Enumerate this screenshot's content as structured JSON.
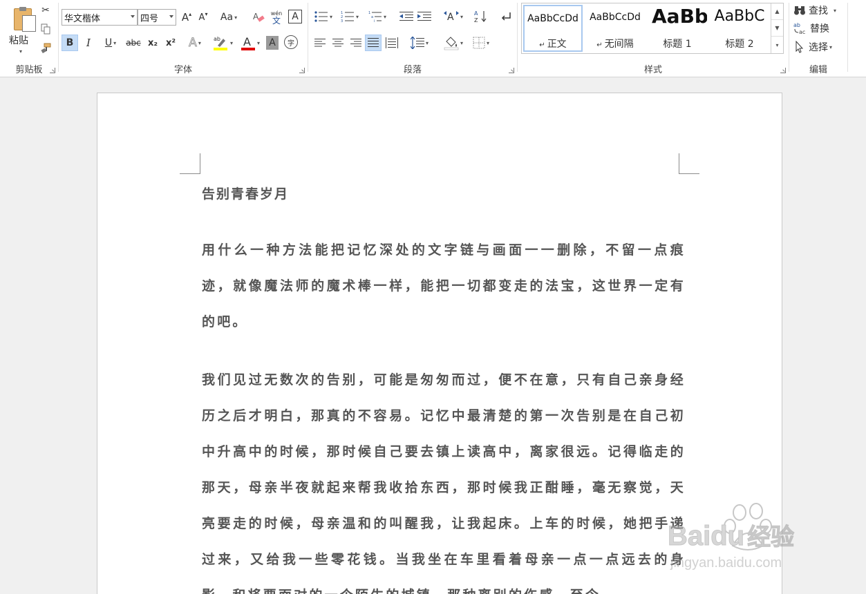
{
  "clipboard": {
    "paste_label": "粘贴",
    "group_label": "剪贴板"
  },
  "font": {
    "family": "华文楷体",
    "size": "四号",
    "group_label": "字体",
    "change_case_label": "Aa",
    "bold": "B",
    "italic": "I",
    "underline": "U",
    "strikethrough": "abc",
    "subscript": "x₂",
    "superscript": "x²",
    "phonetic_top": "wén",
    "phonetic_bottom": "文",
    "border_char": "A",
    "shade_char": "A",
    "circle_char": "字",
    "highlight_color": "#ffff00",
    "font_color": "#e00000"
  },
  "paragraph": {
    "group_label": "段落"
  },
  "styles": {
    "group_label": "样式",
    "items": [
      {
        "sample": "AaBbCcDd",
        "name": "正文",
        "mark": "↵"
      },
      {
        "sample": "AaBbCcDd",
        "name": "无间隔",
        "mark": "↵"
      },
      {
        "sample": "AaBb",
        "name": "标题 1"
      },
      {
        "sample": "AaBbC",
        "name": "标题 2"
      }
    ]
  },
  "editing": {
    "group_label": "编辑",
    "find": "查找",
    "replace": "替换",
    "select": "选择"
  },
  "document": {
    "title": "告别青春岁月",
    "paragraphs": [
      "用什么一种方法能把记忆深处的文字链与画面一一删除，不留一点痕迹，就像魔法师的魔术棒一样，能把一切都变走的法宝，这世界一定有的吧。",
      "我们见过无数次的告别，可能是匆匆而过，便不在意，只有自己亲身经历之后才明白，那真的不容易。记忆中最清楚的第一次告别是在自己初中升高中的时候，那时候自己要去镇上读高中，离家很远。记得临走的那天，母亲半夜就起来帮我收拾东西，那时候我正酣睡，毫无察觉，天亮要走的时候，母亲温和的叫醒我，让我起床。上车的时候，她把手递过来，又给我一些零花钱。当我坐在车里看着母亲一点一点远去的身影，和将要面对的一个陌生的城镇，那种离别的伤感，至今"
    ]
  },
  "watermark": {
    "brand": "Baidu",
    "suffix": "经验",
    "url": "jingyan.baidu.com"
  },
  "colors": {
    "accent": "#2b579a",
    "selected_button": "#c5dcf6"
  }
}
